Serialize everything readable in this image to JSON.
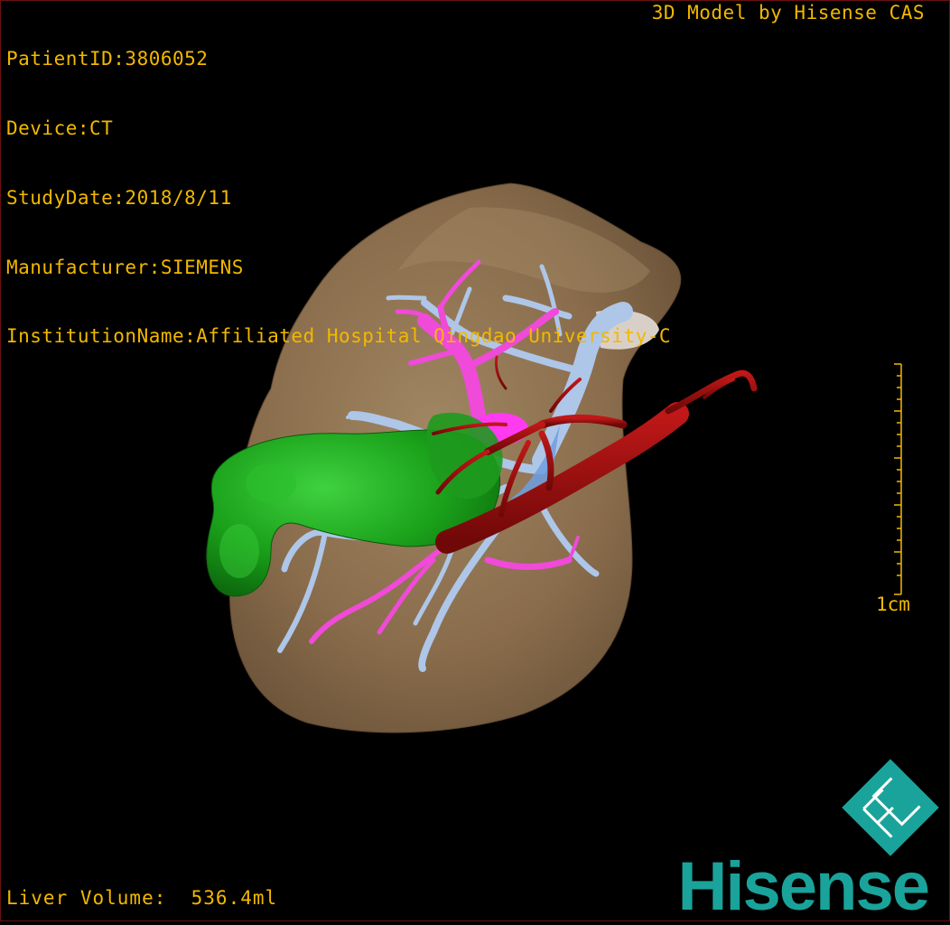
{
  "header": {
    "patient_id": "PatientID:3806052",
    "device": "Device:CT",
    "study_date": "StudyDate:2018/8/11",
    "manufacturer": "Manufacturer:SIEMENS",
    "institution": "InstitutionName:Affiliated Hospital Qingdao University-C"
  },
  "credit": "3D Model by Hisense CAS",
  "footer": {
    "liver_volume": "Liver Volume:  536.4ml"
  },
  "scale_bar": {
    "label": "1cm"
  },
  "brand": {
    "name": "Hisense"
  },
  "colors": {
    "overlay_text": "#f2b800",
    "liver": "#8c6f4e",
    "portal_vein": "#a9c3e6",
    "hepatic_vein": "#f04ad8",
    "artery": "#9a0c0c",
    "tumor_green": "#1fa01f",
    "brand_teal": "#1aa39a"
  },
  "icons": {
    "logo": "hisense-logo-icon"
  }
}
